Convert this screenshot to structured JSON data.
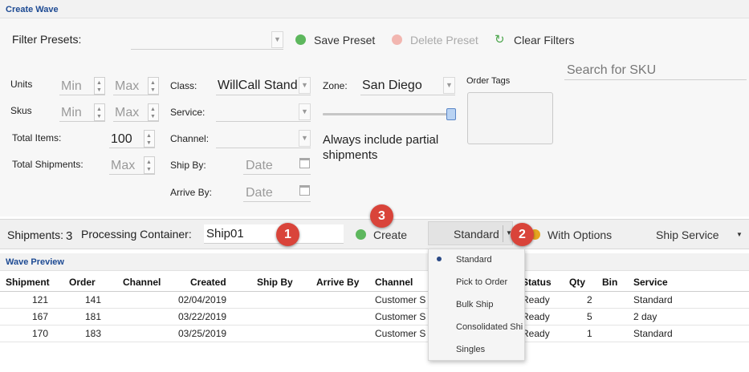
{
  "create_wave": {
    "title": "Create Wave",
    "filter_presets_label": "Filter Presets:",
    "save_preset": "Save Preset",
    "delete_preset": "Delete Preset",
    "clear_filters": "Clear Filters",
    "search_sku_placeholder": "Search for SKU",
    "units_label": "Units",
    "skus_label": "Skus",
    "total_items_label": "Total Items:",
    "total_shipments_label": "Total Shipments:",
    "min_placeholder": "Min",
    "max_placeholder": "Max",
    "total_items_value": "100",
    "class_label": "Class:",
    "class_value": "WillCall Stand",
    "service_label": "Service:",
    "channel_label": "Channel:",
    "ship_by_label": "Ship By:",
    "arrive_by_label": "Arrive By:",
    "date_placeholder": "Date",
    "zone_label": "Zone:",
    "zone_value": "San Diego",
    "partial_line1": "Always include partial",
    "partial_line2": "shipments",
    "order_tags_label": "Order Tags"
  },
  "shipments_bar": {
    "shipments_label": "Shipments:",
    "shipments_count": "3",
    "processing_container_label": "Processing Container:",
    "processing_container_value": "Ship01",
    "create_label": "Create",
    "split_value": "Standard",
    "with_options": "With Options",
    "ship_service": "Ship Service"
  },
  "badges": [
    "1",
    "2",
    "3"
  ],
  "wave_preview": {
    "title": "Wave Preview",
    "columns": [
      "Shipment",
      "Order",
      "Channel",
      "Created",
      "Ship By",
      "Arrive By",
      "Channel",
      "Status",
      "Qty",
      "Bin",
      "Service"
    ],
    "rows": [
      {
        "shipment": "121",
        "order": "141",
        "created": "02/04/2019",
        "channel": "Customer S",
        "status": "Ready",
        "qty": "2",
        "service": "Standard"
      },
      {
        "shipment": "167",
        "order": "181",
        "created": "03/22/2019",
        "channel": "Customer S",
        "status": "Ready",
        "qty": "5",
        "service": "2 day"
      },
      {
        "shipment": "170",
        "order": "183",
        "created": "03/25/2019",
        "channel": "Customer S",
        "status": "Ready",
        "qty": "1",
        "service": "Standard"
      }
    ]
  },
  "wave_type_menu": {
    "items": [
      "Standard",
      "Pick to Order",
      "Bulk Ship",
      "Consolidated Shi",
      "Singles"
    ],
    "selected": "Standard"
  },
  "colors": {
    "accent_title": "#1d4a93",
    "badge": "#d9443a",
    "save_green": "#4caf50"
  }
}
